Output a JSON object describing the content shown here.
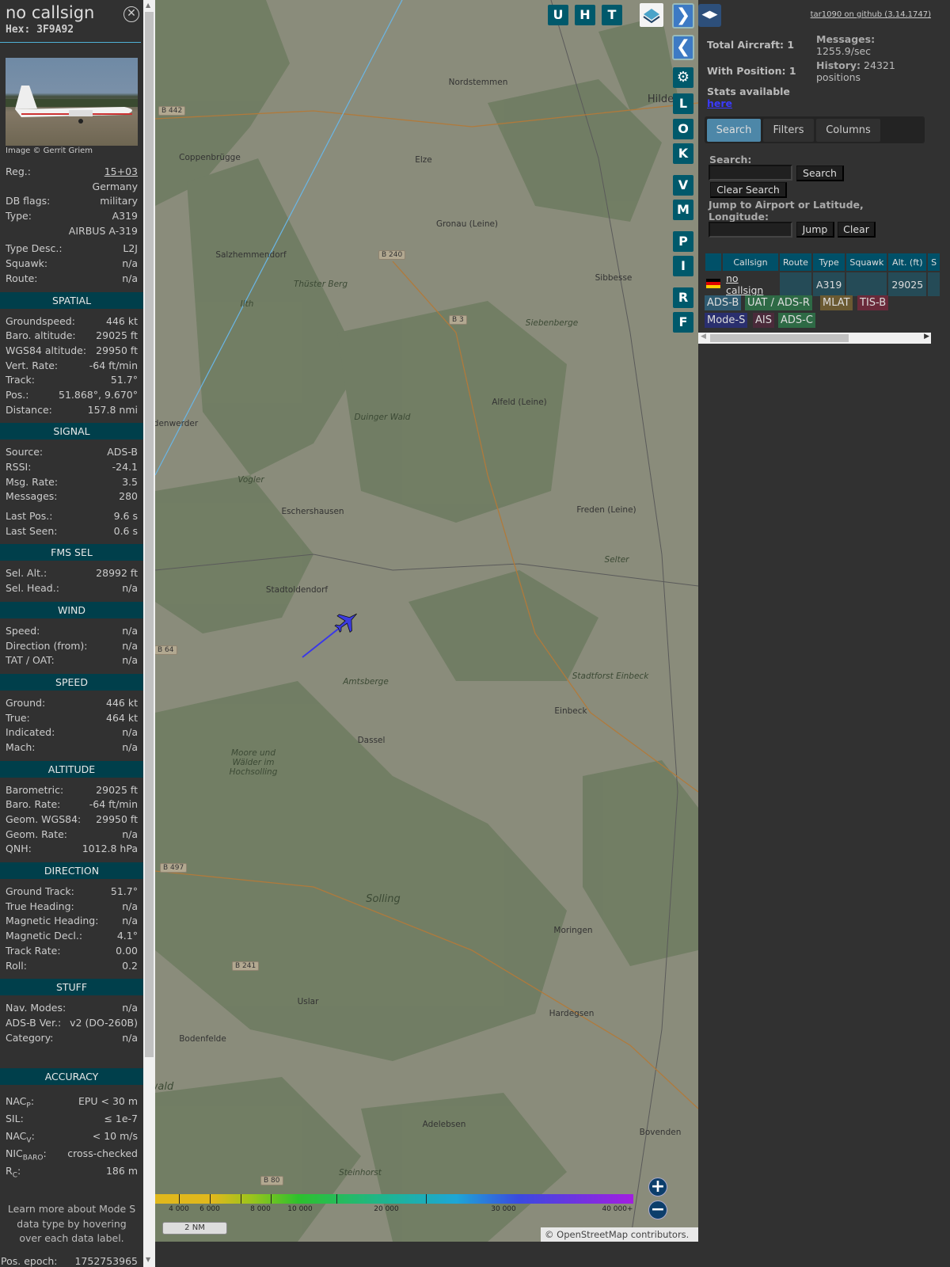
{
  "details": {
    "callsign": "no callsign",
    "hex": "Hex: 3F9A92",
    "image_credit": "Image © Gerrit Griem",
    "top_rows": [
      {
        "label": "Reg.:",
        "value": "15+03"
      },
      {
        "label": "",
        "value": "Germany"
      },
      {
        "label": "DB flags:",
        "value": "military"
      },
      {
        "label": "Type:",
        "value": "A319"
      },
      {
        "label": "",
        "value": "AIRBUS A-319"
      },
      {
        "label": "Type Desc.:",
        "value": "L2J"
      },
      {
        "label": "Squawk:",
        "value": "n/a"
      },
      {
        "label": "Route:",
        "value": "n/a"
      }
    ],
    "sections": [
      {
        "title": "SPATIAL",
        "rows": [
          {
            "label": "Groundspeed:",
            "value": "446 kt"
          },
          {
            "label": "Baro. altitude:",
            "value": "29025 ft"
          },
          {
            "label": "WGS84 altitude:",
            "value": "29950 ft"
          },
          {
            "label": "Vert. Rate:",
            "value": "-64 ft/min"
          },
          {
            "label": "Track:",
            "value": "51.7°"
          },
          {
            "label": "Pos.:",
            "value": "51.868°, 9.670°"
          },
          {
            "label": "Distance:",
            "value": "157.8 nmi"
          }
        ]
      },
      {
        "title": "SIGNAL",
        "rows": [
          {
            "label": "Source:",
            "value": "ADS-B"
          },
          {
            "label": "RSSI:",
            "value": "-24.1"
          },
          {
            "label": "Msg. Rate:",
            "value": "3.5"
          },
          {
            "label": "Messages:",
            "value": "280"
          },
          {
            "label": "Last Pos.:",
            "value": "9.6 s"
          },
          {
            "label": "Last Seen:",
            "value": "0.6 s"
          }
        ]
      },
      {
        "title": "FMS SEL",
        "rows": [
          {
            "label": "Sel. Alt.:",
            "value": "28992 ft"
          },
          {
            "label": "Sel. Head.:",
            "value": "n/a"
          }
        ]
      },
      {
        "title": "WIND",
        "rows": [
          {
            "label": "Speed:",
            "value": "n/a"
          },
          {
            "label": "Direction (from):",
            "value": "n/a"
          },
          {
            "label": "TAT / OAT:",
            "value": "n/a"
          }
        ]
      },
      {
        "title": "SPEED",
        "rows": [
          {
            "label": "Ground:",
            "value": "446 kt"
          },
          {
            "label": "True:",
            "value": "464 kt"
          },
          {
            "label": "Indicated:",
            "value": "n/a"
          },
          {
            "label": "Mach:",
            "value": "n/a"
          }
        ]
      },
      {
        "title": "ALTITUDE",
        "rows": [
          {
            "label": "Barometric:",
            "value": "29025 ft"
          },
          {
            "label": "Baro. Rate:",
            "value": "-64 ft/min"
          },
          {
            "label": "Geom. WGS84:",
            "value": "29950 ft"
          },
          {
            "label": "Geom. Rate:",
            "value": "n/a"
          },
          {
            "label": "QNH:",
            "value": "1012.8 hPa"
          }
        ]
      },
      {
        "title": "DIRECTION",
        "rows": [
          {
            "label": "Ground Track:",
            "value": "51.7°"
          },
          {
            "label": "True Heading:",
            "value": "n/a"
          },
          {
            "label": "Magnetic Heading:",
            "value": "n/a"
          },
          {
            "label": "Magnetic Decl.:",
            "value": "4.1°"
          },
          {
            "label": "Track Rate:",
            "value": "0.00"
          },
          {
            "label": "Roll:",
            "value": "0.2"
          }
        ]
      },
      {
        "title": "STUFF",
        "rows": [
          {
            "label": "Nav. Modes:",
            "value": "n/a"
          },
          {
            "label": "ADS-B Ver.:",
            "value": "v2 (DO-260B)"
          },
          {
            "label": "Category:",
            "value": "n/a"
          }
        ]
      }
    ],
    "accuracy": {
      "title": "ACCURACY",
      "nacp": {
        "label": "NAC",
        "sub": "P",
        "value": "EPU < 30 m"
      },
      "sil": {
        "label": "SIL:",
        "value": "≤ 1e-7"
      },
      "nacv": {
        "label": "NAC",
        "sub": "V",
        "value": "< 10 m/s"
      },
      "nicbaro": {
        "label": "NIC",
        "sub": "BARO",
        "value": "cross-checked"
      },
      "rc": {
        "label": "R",
        "sub": "C",
        "value": "186 m"
      }
    },
    "note": "Learn more about Mode S data type by hovering over each data label.",
    "pos_epoch": {
      "label": "Pos. epoch:",
      "value": "1752753965"
    }
  },
  "map": {
    "top_buttons": [
      "U",
      "H",
      "T"
    ],
    "side_buttons": [
      "L",
      "O",
      "K",
      "V",
      "M",
      "P",
      "I",
      "R",
      "F"
    ],
    "places": [
      {
        "n": "Nordstemmen",
        "c": ""
      },
      {
        "n": "Hildesh",
        "c": "big"
      },
      {
        "n": "Coppenbrügge",
        "c": ""
      },
      {
        "n": "Elze",
        "c": ""
      },
      {
        "n": "Gronau (Leine)",
        "c": ""
      },
      {
        "n": "Salzhemmendorf",
        "c": ""
      },
      {
        "n": "Sibbesse",
        "c": ""
      },
      {
        "n": "Siebenberge",
        "c": "it"
      },
      {
        "n": "Thüster Berg",
        "c": "it"
      },
      {
        "n": "Alfeld (Leine)",
        "c": ""
      },
      {
        "n": "Duinger Wald",
        "c": "it"
      },
      {
        "n": "denwerder",
        "c": ""
      },
      {
        "n": "Vogler",
        "c": "it"
      },
      {
        "n": "Eschershausen",
        "c": ""
      },
      {
        "n": "Freden (Leine)",
        "c": ""
      },
      {
        "n": "Stadtoldendorf",
        "c": ""
      },
      {
        "n": "Amtsberge",
        "c": "it"
      },
      {
        "n": "Stadtforst Einbeck",
        "c": "it"
      },
      {
        "n": "Einbeck",
        "c": ""
      },
      {
        "n": "Dassel",
        "c": ""
      },
      {
        "n": "Moore und Wälder im Hochsolling",
        "c": "it"
      },
      {
        "n": "Solling",
        "c": "it big"
      },
      {
        "n": "Moringen",
        "c": ""
      },
      {
        "n": "Uslar",
        "c": ""
      },
      {
        "n": "Hardegsen",
        "c": ""
      },
      {
        "n": "Bodenfelde",
        "c": ""
      },
      {
        "n": "Adelebsen",
        "c": ""
      },
      {
        "n": "Bovenden",
        "c": ""
      },
      {
        "n": "Steinhorst",
        "c": "it"
      },
      {
        "n": "Ilth",
        "c": "it"
      },
      {
        "n": "wald",
        "c": "it big"
      },
      {
        "n": "Selter",
        "c": "it"
      }
    ],
    "roads": [
      "B 442",
      "B 240",
      "B 3",
      "B 64",
      "B 497",
      "B 241",
      "B 80"
    ],
    "altitude_legend": [
      "4 000",
      "6 000",
      "8 000",
      "10 000",
      "20 000",
      "30 000",
      "40 000+"
    ],
    "scale": "2 NM",
    "attribution": "© OpenStreetMap contributors."
  },
  "right": {
    "github": "tar1090 on github (3.14.1747)",
    "total_aircraft": "Total Aircraft: 1",
    "with_position": "With Position: 1",
    "messages_label": "Messages:",
    "messages_value": "1255.9/sec",
    "history_label": "History:",
    "history_value": "24321 positions",
    "stats": "Stats available",
    "stats_link": "here",
    "tabs": [
      "Search",
      "Filters",
      "Columns"
    ],
    "search_label": "Search:",
    "search_btn": "Search",
    "clear_search_btn": "Clear Search",
    "jump_label": "Jump to Airport or Latitude, Longitude:",
    "jump_btn": "Jump",
    "clear_btn": "Clear",
    "columns": [
      "Callsign",
      "Route",
      "Type",
      "Squawk",
      "Alt. (ft)",
      "S"
    ],
    "row": {
      "callsign": "no callsign",
      "route": "",
      "type": "A319",
      "squawk": "",
      "alt": "29025"
    },
    "badges": [
      {
        "t": "ADS-B",
        "c": "#2e5a70"
      },
      {
        "t": "UAT / ADS-R",
        "c": "#2e6a45"
      },
      {
        "t": "MLAT",
        "c": "#6b5a32"
      },
      {
        "t": "TIS-B",
        "c": "#6a2a3a"
      },
      {
        "t": "Mode-S",
        "c": "#2a2f6e"
      },
      {
        "t": "AIS",
        "c": "#4a2a3a"
      },
      {
        "t": "ADS-C",
        "c": "#2e6a45"
      }
    ]
  }
}
